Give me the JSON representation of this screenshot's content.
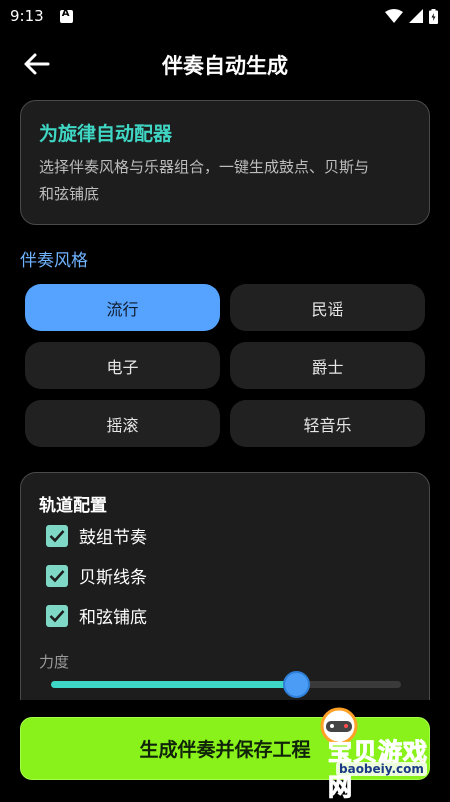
{
  "status_bar": {
    "time": "9:13"
  },
  "app_bar": {
    "title": "伴奏自动生成"
  },
  "intro": {
    "title": "为旋律自动配器",
    "desc_line1": "选择伴奏风格与乐器组合，一键生成鼓点、贝斯与",
    "desc_line2": "和弦铺底"
  },
  "style_section": {
    "label": "伴奏风格",
    "options": [
      "流行",
      "民谣",
      "电子",
      "爵士",
      "摇滚",
      "轻音乐"
    ],
    "selected": "流行"
  },
  "tracks": {
    "title": "轨道配置",
    "items": [
      {
        "label": "鼓组节奏",
        "checked": true
      },
      {
        "label": "贝斯线条",
        "checked": true
      },
      {
        "label": "和弦铺底",
        "checked": true
      }
    ],
    "strength_label": "力度",
    "strength_value": 0.7
  },
  "generate_button": {
    "label": "生成伴奏并保存工程"
  },
  "watermark": {
    "text": "宝贝游戏网",
    "url": "baobeiy.com"
  },
  "colors": {
    "accent_teal": "#3fd7c4",
    "selected_chip": "#56a2ff",
    "section_label": "#6fb3ff",
    "button_green": "#88f21a"
  }
}
